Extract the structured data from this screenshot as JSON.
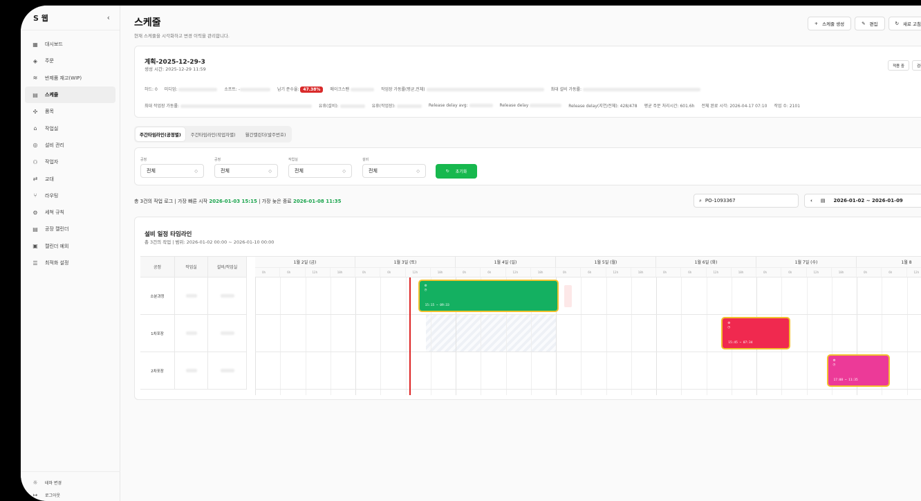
{
  "sidebar": {
    "brand": "S 웹",
    "collapse": "‹",
    "items": [
      {
        "label": "대시보드",
        "icon": "dashboard-icon",
        "glyph": "▦"
      },
      {
        "label": "주문",
        "icon": "order-icon",
        "glyph": "◈"
      },
      {
        "label": "반제품 재고(WIP)",
        "icon": "stack-icon",
        "glyph": "≋"
      },
      {
        "label": "스케줄",
        "icon": "calendar-icon",
        "glyph": "▤",
        "active": true
      },
      {
        "label": "품목",
        "icon": "item-icon",
        "glyph": "✣"
      },
      {
        "label": "작업실",
        "icon": "workroom-icon",
        "glyph": "⌂"
      },
      {
        "label": "설비 관리",
        "icon": "equipment-icon",
        "glyph": "◎"
      },
      {
        "label": "작업자",
        "icon": "workers-icon",
        "glyph": "⚇"
      },
      {
        "label": "교대",
        "icon": "shift-icon",
        "glyph": "⇄"
      },
      {
        "label": "라우팅",
        "icon": "routing-icon",
        "glyph": "⑂"
      },
      {
        "label": "세척 규칙",
        "icon": "cleaning-icon",
        "glyph": "⚙"
      },
      {
        "label": "공장 캘린더",
        "icon": "factory-calendar-icon",
        "glyph": "▤"
      },
      {
        "label": "캘린더 예외",
        "icon": "calendar-exception-icon",
        "glyph": "▣"
      },
      {
        "label": "최적화 설정",
        "icon": "settings-sliders-icon",
        "glyph": "☰"
      }
    ],
    "footer": [
      {
        "label": "테마 변경",
        "icon": "theme-icon",
        "glyph": "☼"
      },
      {
        "label": "로그아웃",
        "icon": "logout-icon",
        "glyph": "↦"
      }
    ]
  },
  "header": {
    "title": "스케줄",
    "subtitle": "현재 스케줄을 시각화하고 변경 이력을 관리합니다.",
    "actions": {
      "create": "스케줄 생성",
      "edit": "편집",
      "refresh": "새로 고침"
    }
  },
  "plan": {
    "title": "계획-2025-12-29-3",
    "created": "생성 시간: 2025-12-29 11:59",
    "btn_apply": "적용 중",
    "btn_result": "검증 결과",
    "row1": {
      "hard": "하드: 0",
      "medium": "미디엄:",
      "soft": "소프트: -",
      "ontime_label": "납기 준수율:",
      "ontime_value": "47.38%",
      "makespan": "메이크스팬",
      "workroom_util": "작업장 가동률(평균,전체)",
      "max_equip": "최대 설비 가동률:"
    },
    "row2": {
      "max_workroom": "최대 작업장 가동률:",
      "idle_equip": "유휴(설비):",
      "idle_workroom": "유휴(작업장):",
      "release_avg": "Release delay avg:",
      "release_delay": "Release delay",
      "release_ratio": "Release delay(지연/전체): 428/478",
      "avg_lead": "평균 주문 처리시간: 601.6h",
      "end_time": "전체 완료 시각: 2026-04-17 07:10",
      "job_count": "작업 수: 2101"
    }
  },
  "tabs": [
    "주간타임라인(공정별)",
    "주간타임라인(작업자별)",
    "월간캘린더(발주번호)"
  ],
  "filters": {
    "items": [
      {
        "label": "공정",
        "value": "전체"
      },
      {
        "label": "공정",
        "value": "전체"
      },
      {
        "label": "작업실",
        "value": "전체"
      },
      {
        "label": "설비",
        "value": "전체"
      }
    ],
    "reset": "초기화"
  },
  "summary": {
    "prefix": "총 3건의 작업 로그 | 가장 빠른 시작",
    "earliest": "2026-01-03 15:15",
    "mid": "| 가장 늦은 종료",
    "latest": "2026-01-08 11:35"
  },
  "search": {
    "value": "PO-1093367"
  },
  "date_range": {
    "prev": "‹",
    "value": "2026-01-02 ~ 2026-01-09"
  },
  "timeline": {
    "title": "설비 일정 타임라인",
    "subtitle": "총 3건의 작업 | 범위: 2026-01-02 00:00 ~ 2026-01-10 00:00",
    "columns": [
      "공정",
      "작업실",
      "설비/작업실"
    ],
    "days": [
      "1월 2일 (금)",
      "1월 3일 (토)",
      "1월 4일 (일)",
      "1월 5일 (월)",
      "1월 6일 (화)",
      "1월 7일 (수)",
      "1월 8"
    ],
    "hours": [
      "0h",
      "6h",
      "12h",
      "18h"
    ],
    "rows": [
      {
        "process": "소분과정"
      },
      {
        "process": "1차포장"
      },
      {
        "process": "2차포장"
      }
    ],
    "jobs": [
      {
        "row": 0,
        "start_day": 1.625,
        "end_day": 3.03,
        "color": "#14b061",
        "time": "15:15 ~ 09:33"
      },
      {
        "row": 1,
        "start_day": 4.65,
        "end_day": 5.34,
        "color": "#f0294f",
        "time": "15:45 ~ 07:34"
      },
      {
        "row": 2,
        "start_day": 5.7,
        "end_day": 6.33,
        "color": "#ec3a98",
        "time": "17:08 ~ 11:35"
      }
    ],
    "now_day": 1.54,
    "colors": {
      "now": "#dd2222",
      "job_border": "#f2c12e",
      "accent_green": "#17b84e"
    }
  }
}
